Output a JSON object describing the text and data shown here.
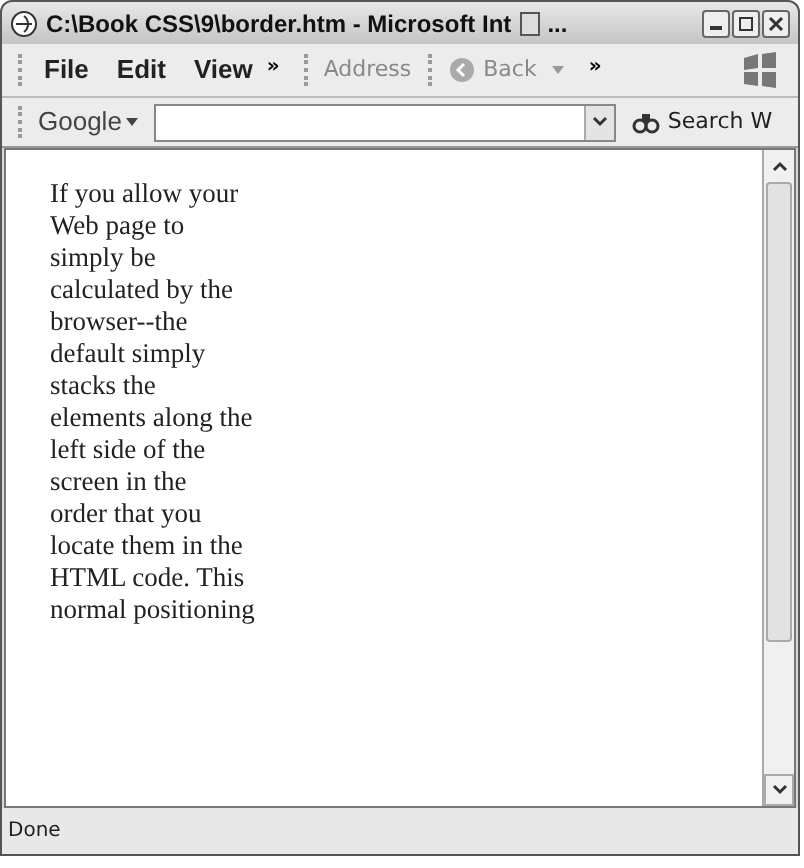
{
  "window": {
    "title": "C:\\Book CSS\\9\\border.htm - Microsoft Int",
    "title_ellipsis": "..."
  },
  "menu": [
    "File",
    "Edit",
    "View"
  ],
  "menu_chevron": "»",
  "address_label": "Address",
  "back_button": "Back",
  "toolbar_chevron": "»",
  "google_bar": {
    "brand": "Google",
    "search_button": "Search W"
  },
  "content": {
    "lines": [
      "If you allow your",
      "Web page to",
      "simply be",
      "calculated by the",
      "browser--the",
      "default simply",
      "stacks the",
      "elements along the",
      "left side of the",
      "screen in the",
      "order that you",
      "locate them in the",
      "HTML code. This",
      "normal positioning"
    ]
  },
  "status_bar": "Done"
}
